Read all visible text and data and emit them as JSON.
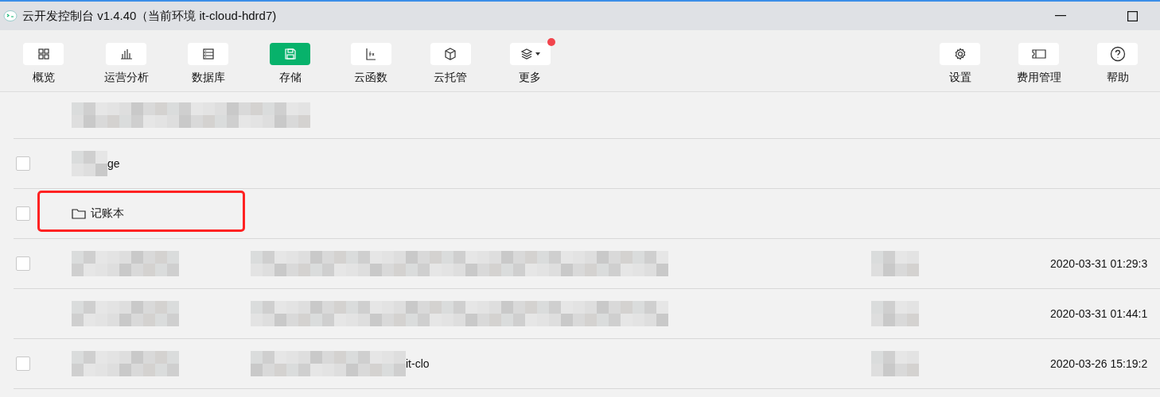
{
  "window": {
    "title": "云开发控制台 v1.4.40（当前环境 it-cloud-hdrd7)"
  },
  "toolbar": {
    "left": [
      {
        "label": "概览",
        "selected": false
      },
      {
        "label": "运营分析",
        "selected": false
      },
      {
        "label": "数据库",
        "selected": false
      },
      {
        "label": "存储",
        "selected": true
      },
      {
        "label": "云函数",
        "selected": false
      },
      {
        "label": "云托管",
        "selected": false
      },
      {
        "label": "更多",
        "selected": false,
        "kind": "menu"
      }
    ],
    "right": [
      {
        "label": "设置",
        "selected": false
      },
      {
        "label": "费用管理",
        "selected": false
      },
      {
        "label": "帮助",
        "selected": false
      }
    ]
  },
  "rows": [
    {
      "cells": [
        {
          "kind": "blur-wide"
        }
      ]
    },
    {
      "checked": false,
      "cells": [
        {
          "kind": "blur-text",
          "text": "ge"
        }
      ]
    },
    {
      "checked": false,
      "highlight": true,
      "cells": [
        {
          "kind": "folder",
          "text": "记账本"
        }
      ]
    },
    {
      "checked": false,
      "cells": [
        {
          "kind": "blur"
        },
        {
          "kind": "blur"
        },
        {
          "kind": "blur"
        },
        {
          "kind": "text",
          "text": "2020-03-31 01:29:3"
        }
      ]
    },
    {
      "cells": [
        {
          "kind": "blur"
        },
        {
          "kind": "blur"
        },
        {
          "kind": "blur"
        },
        {
          "kind": "text",
          "text": "2020-03-31 01:44:1"
        }
      ]
    },
    {
      "checked": false,
      "cells": [
        {
          "kind": "blur"
        },
        {
          "kind": "blur-text",
          "text": "it-clo"
        },
        {
          "kind": "blur"
        },
        {
          "kind": "text",
          "text": "2020-03-26 15:19:2"
        }
      ]
    }
  ]
}
